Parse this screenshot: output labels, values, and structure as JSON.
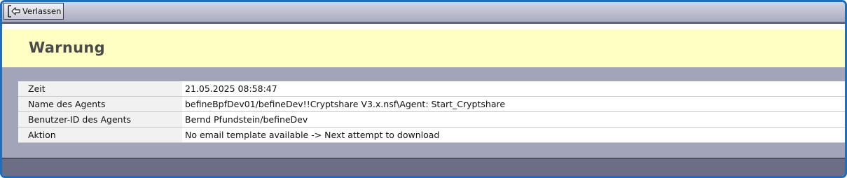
{
  "toolbar": {
    "leave_label": "Verlassen",
    "leave_icon": "exit-icon"
  },
  "banner": {
    "title": "Warnung"
  },
  "details": [
    {
      "label": "Zeit",
      "value": "21.05.2025 08:58:47"
    },
    {
      "label": "Name des Agents",
      "value": "befineBpfDev01/befineDev!!Cryptshare V3.x.nsf\\Agent:  Start_Cryptshare"
    },
    {
      "label": "Benutzer-ID des Agents",
      "value": "Bernd Pfundstein/befineDev"
    },
    {
      "label": "Aktion",
      "value": "No email template available -> Next attempt to download"
    }
  ],
  "colors": {
    "frame_border": "#1d6fba",
    "banner_bg": "#ffffc4",
    "page_bg": "#a2a4ba",
    "footer_bg": "#6b6e85"
  }
}
